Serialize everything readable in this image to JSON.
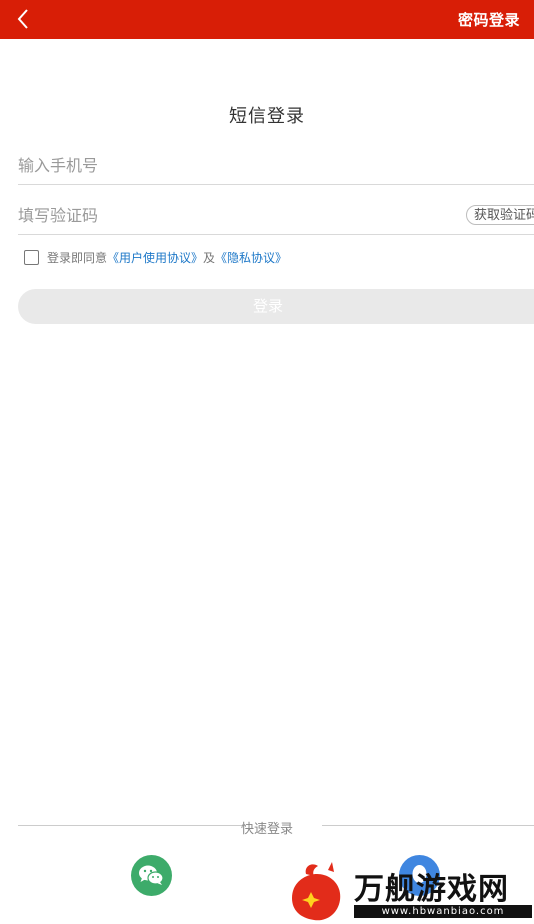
{
  "header": {
    "back_icon": "chevron-left-icon",
    "switch_label": "密码登录",
    "bg_color": "#d81e06"
  },
  "title": "短信登录",
  "form": {
    "phone_placeholder": "输入手机号",
    "code_placeholder": "填写验证码",
    "get_code_label": "获取验证码",
    "agreement": {
      "prefix": "登录即同意",
      "user_agreement": "《用户使用协议》",
      "conjunction": "及",
      "privacy": "《隐私协议》",
      "checked": false
    },
    "login_label": "登录"
  },
  "quick_login": {
    "label": "快速登录",
    "providers": [
      "wechat-icon",
      "qq-icon"
    ]
  },
  "watermark": {
    "name": "万舰游戏网",
    "url": "www.hbwanbiao.com"
  },
  "colors": {
    "accent": "#d81e06",
    "link": "#1e78c8",
    "wechat": "#3dab6a",
    "disabled_button": "#e9e9e9"
  }
}
